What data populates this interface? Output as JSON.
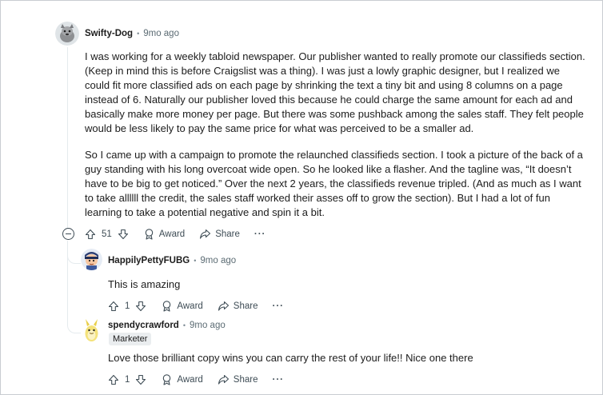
{
  "comments": [
    {
      "author": "Swifty-Dog",
      "time": "9mo ago",
      "paragraphs": [
        "I was working for a weekly tabloid newspaper. Our publisher wanted to really promote our classifieds section. (Keep in mind this is before Craigslist was a thing). I was just a lowly graphic designer, but I realized we could fit more classified ads on each page by shrinking the text a tiny bit and using 8 columns on a page instead of 6. Naturally our publisher loved this because he could charge the same amount for each ad and basically make more money per page. But there was some pushback among the sales staff. They felt people would be less likely to pay the same price for what was perceived to be a smaller ad.",
        "So I came up with a campaign to promote the relaunched classifieds section. I took a picture of the back of a guy standing with his long overcoat wide open. So he looked like a flasher. And the tagline was, “It doesn’t have to be big to get noticed.” Over the next 2 years, the classifieds revenue tripled. (And as much as I want to take allllll the credit, the sales staff worked their asses off to grow the section). But I had a lot of fun learning to take a potential negative and spin it a bit."
      ],
      "votes": "51",
      "award": "Award",
      "share": "Share",
      "more": "···"
    },
    {
      "author": "HappilyPettyFUBG",
      "time": "9mo ago",
      "text": "This is amazing",
      "votes": "1",
      "award": "Award",
      "share": "Share",
      "more": "···"
    },
    {
      "author": "spendycrawford",
      "time": "9mo ago",
      "flair": "Marketer",
      "text": "Love those brilliant copy wins you can carry the rest of your life!! Nice one there",
      "votes": "1",
      "award": "Award",
      "share": "Share",
      "more": "···"
    }
  ],
  "separator": "•",
  "colors": {
    "text": "#1c1c1c",
    "meta": "#5c6c74",
    "thread": "#e5ebee"
  }
}
